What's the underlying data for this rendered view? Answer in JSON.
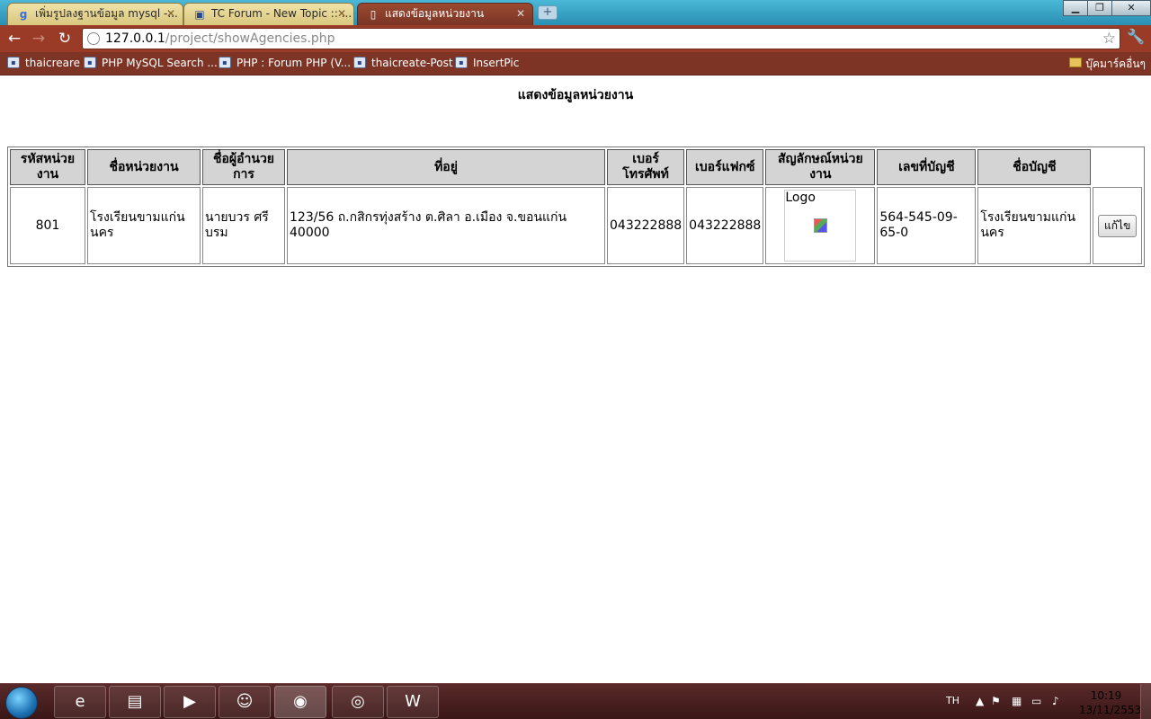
{
  "browser": {
    "tabs": [
      {
        "title": "เพิ่มรูปลงฐานข้อมูล mysql -...",
        "icon": "google-icon"
      },
      {
        "title": "TC Forum - New Topic :: ...",
        "icon": "site-icon"
      },
      {
        "title": "แสดงข้อมูลหน่วยงาน",
        "icon": "page-icon"
      }
    ],
    "url_host": "127.0.0.1",
    "url_path": "/project/showAgencies.php",
    "bookmarks": [
      "thaicreare",
      "PHP MySQL Search ...",
      "PHP : Forum PHP (V...",
      "thaicreate-Post",
      "InsertPic"
    ],
    "other_bookmarks": "บุ๊คมาร์คอื่นๆ"
  },
  "page": {
    "title": "แสดงข้อมูลหน่วยงาน",
    "table": {
      "headers": [
        "รหัสหน่วยงาน",
        "ชื่อหน่วยงาน",
        "ชื่อผู้อำนวยการ",
        "ที่อยู่",
        "เบอร์โทรศัพท์",
        "เบอร์แฟกซ์",
        "สัญลักษณ์หน่วยงาน",
        "เลขที่บัญชี",
        "ชื่อบัญชี"
      ],
      "rows": [
        {
          "code": "801",
          "name": "โรงเรียนขามแก่นนคร",
          "director": "นายบวร ศรีบรม",
          "address": "123/56 ถ.กสิกรทุ่งสร้าง ต.ศิลา อ.เมือง จ.ขอนแก่น 40000",
          "phone": "043222888",
          "fax": "043222888",
          "logo_alt": "Logo",
          "account_no": "564-545-09-65-0",
          "account_name": "โรงเรียนขามแก่นนคร",
          "edit_label": "แก้ไข"
        }
      ]
    }
  },
  "taskbar": {
    "language": "TH",
    "time": "10:19",
    "date": "13/11/2553"
  }
}
